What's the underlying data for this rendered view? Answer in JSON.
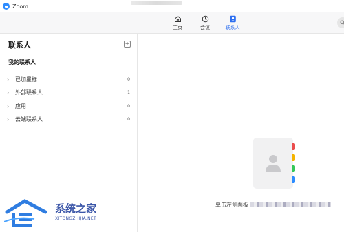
{
  "window": {
    "title": "Zoom"
  },
  "nav": {
    "tabs": [
      {
        "label": "主页",
        "icon": "home-icon",
        "active": false
      },
      {
        "label": "会议",
        "icon": "clock-icon",
        "active": false
      },
      {
        "label": "联系人",
        "icon": "contacts-icon",
        "active": true
      }
    ]
  },
  "sidebar": {
    "title": "联系人",
    "section_title": "我的联系人",
    "groups": [
      {
        "label": "已加星标",
        "count": "0"
      },
      {
        "label": "外部联系人",
        "count": "1"
      },
      {
        "label": "应用",
        "count": "0"
      },
      {
        "label": "云端联系人",
        "count": "0"
      }
    ]
  },
  "main": {
    "hint": "单击左侧面板"
  },
  "watermark": {
    "brand": "系统之家",
    "url": "XITONGZHIJIA.NET"
  },
  "colors": {
    "accent": "#2d6ff0",
    "tab_red": "#ea4d4d",
    "tab_yellow": "#f4b400",
    "tab_green": "#34c759",
    "tab_blue": "#2d8cff"
  }
}
